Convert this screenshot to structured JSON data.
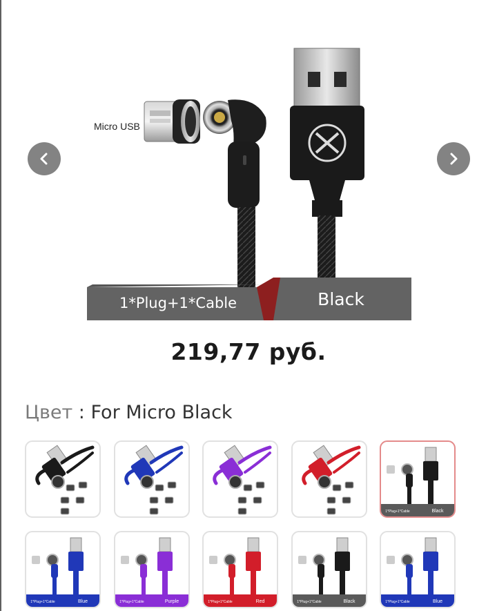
{
  "product_image": {
    "micro_label": "Micro USB",
    "option_label": "1*Plug+1*Cable",
    "color_label": "Black",
    "palette": {
      "cable": "#1c1c1c",
      "banner": "#636363",
      "banner_accent": "#8d1f1f"
    }
  },
  "gallery": {
    "prev_icon": "chevron-left-icon",
    "next_icon": "chevron-right-icon"
  },
  "price": "219,77 руб.",
  "color": {
    "label": "Цвет",
    "separator": " : ",
    "value": "For Micro Black"
  },
  "swatches": [
    {
      "name": "black",
      "color": "#1a1a1a",
      "style": "coiled",
      "selected": false
    },
    {
      "name": "blue",
      "color": "#2038b8",
      "style": "coiled",
      "selected": false
    },
    {
      "name": "purple",
      "color": "#8a2ed6",
      "style": "coiled",
      "selected": false
    },
    {
      "name": "red",
      "color": "#d21e2a",
      "style": "coiled",
      "selected": false
    },
    {
      "name": "black-micro",
      "color": "#1a1a1a",
      "style": "banner",
      "selected": true,
      "tag": "1*Plug+1*Cable",
      "label": "Black"
    },
    {
      "name": "blue-micro",
      "color": "#2038b8",
      "style": "banner",
      "selected": false,
      "tag": "1*Plug+1*Cable",
      "label": "Blue"
    },
    {
      "name": "purple-micro",
      "color": "#8a2ed6",
      "style": "banner",
      "selected": false,
      "tag": "1*Plug+1*Cable",
      "label": "Purple"
    },
    {
      "name": "red-micro",
      "color": "#d21e2a",
      "style": "banner",
      "selected": false,
      "tag": "1*Plug+1*Cable",
      "label": "Red"
    },
    {
      "name": "black-type-c",
      "color": "#1a1a1a",
      "style": "banner",
      "selected": false,
      "tag": "1*Plug+1*Cable",
      "label": "Black"
    },
    {
      "name": "blue-type-c",
      "color": "#2038b8",
      "style": "banner",
      "selected": false,
      "tag": "1*Plug+1*Cable",
      "label": "Blue"
    }
  ]
}
